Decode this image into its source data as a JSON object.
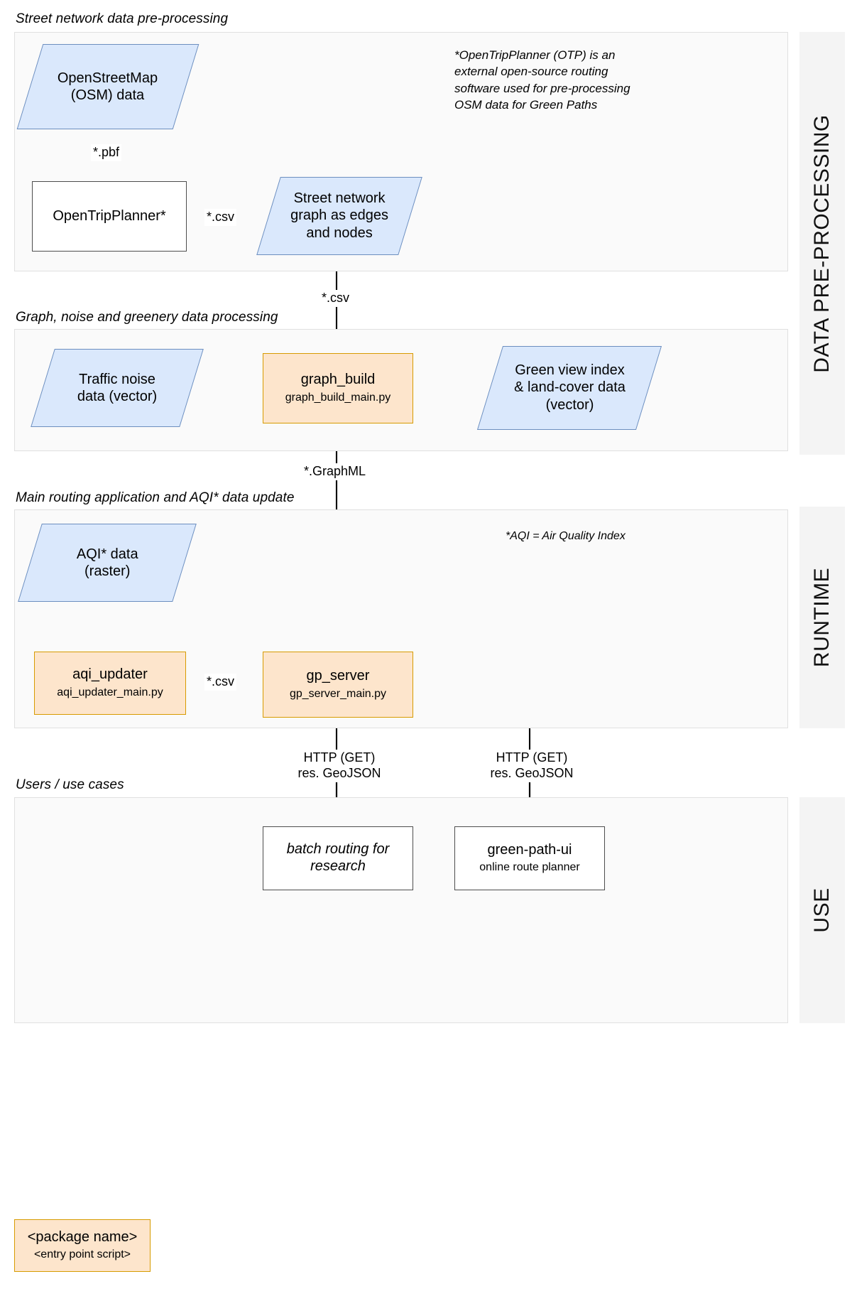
{
  "sections": [
    {
      "title": "Street network data pre-processing"
    },
    {
      "title": "Graph, noise and greenery data processing"
    },
    {
      "title": "Main routing application and AQI* data update"
    },
    {
      "title": "Users / use cases"
    }
  ],
  "bands": [
    {
      "label": "DATA PRE-PROCESSING"
    },
    {
      "label": "RUNTIME"
    },
    {
      "label": "USE"
    }
  ],
  "notes": {
    "otp": "*OpenTripPlanner (OTP) is an external open-source routing software used for pre-processing OSM data for Green Paths",
    "otp_lines": [
      "*OpenTripPlanner (OTP) is an",
      "external open-source routing",
      "software used for pre-processing",
      "OSM data for Green Paths"
    ],
    "aqi": "*AQI = Air Quality Index"
  },
  "nodes": {
    "osm": {
      "line1": "OpenStreetMap",
      "line2": "(OSM) data"
    },
    "otp": {
      "label": "OpenTripPlanner*"
    },
    "street_graph": {
      "line1": "Street network",
      "line2": "graph as edges",
      "line3": "and nodes"
    },
    "traffic_noise": {
      "line1": "Traffic noise",
      "line2": "data (vector)"
    },
    "graph_build": {
      "name": "graph_build",
      "script": "graph_build_main.py"
    },
    "green_view": {
      "line1": "Green view index",
      "line2": "& land-cover data",
      "line3": "(vector)"
    },
    "aqi_data": {
      "line1": "AQI* data",
      "line2": "(raster)"
    },
    "aqi_updater": {
      "name": "aqi_updater",
      "script": "aqi_updater_main.py"
    },
    "gp_server": {
      "name": "gp_server",
      "script": "gp_server_main.py"
    },
    "batch_routing": {
      "line1": "batch routing for",
      "line2": "research"
    },
    "green_path_ui": {
      "name": "green-path-ui",
      "sub": "online route planner"
    }
  },
  "edges": {
    "pbf": "*.pbf",
    "csv_otp": "*.csv",
    "csv_graph": "*.csv",
    "graphml": "*.GraphML",
    "csv_aqi": "*.csv",
    "http_batch_l1": "HTTP (GET)",
    "http_batch_l2": "res. GeoJSON",
    "http_ui_l1": "HTTP (GET)",
    "http_ui_l2": "res. GeoJSON"
  },
  "legend": {
    "package_name": "<package name>",
    "entry_point": "<entry point script>"
  },
  "colors": {
    "data_fill": "#dae8fc",
    "data_stroke": "#6c8ebf",
    "package_fill": "#fde5cc",
    "package_stroke": "#d79b00",
    "panel_fill": "#fafafa",
    "band_fill": "#f4f4f4",
    "box_stroke": "#4d4d4d"
  }
}
